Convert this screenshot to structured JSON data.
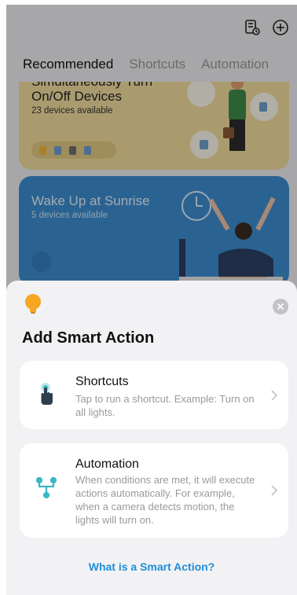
{
  "header": {
    "icons": [
      "document-clock-icon",
      "plus-circle-icon"
    ]
  },
  "tabs": [
    {
      "label": "Recommended",
      "active": true
    },
    {
      "label": "Shortcuts",
      "active": false
    },
    {
      "label": "Automation",
      "active": false
    }
  ],
  "cards": [
    {
      "title": "Simultaneously Turn On/Off Devices",
      "subtitle": "23 devices available",
      "color": "#f4dfa0"
    },
    {
      "title": "Wake Up at Sunrise",
      "subtitle": "5 devices available",
      "color": "#3d8fd1"
    }
  ],
  "sheet": {
    "icon": "lightbulb-icon",
    "title": "Add Smart Action",
    "options": [
      {
        "icon": "tap-hand-icon",
        "title": "Shortcuts",
        "description": "Tap to run a shortcut. Example: Turn on all lights."
      },
      {
        "icon": "flow-branch-icon",
        "title": "Automation",
        "description": "When conditions are met, it will execute actions automatically. For example, when a camera detects motion, the lights will turn on."
      }
    ],
    "help_link": "What is a Smart Action?"
  },
  "colors": {
    "accent": "#1f8ed6",
    "bulb": "#f5a623",
    "flow_icon": "#3bb8c4"
  }
}
